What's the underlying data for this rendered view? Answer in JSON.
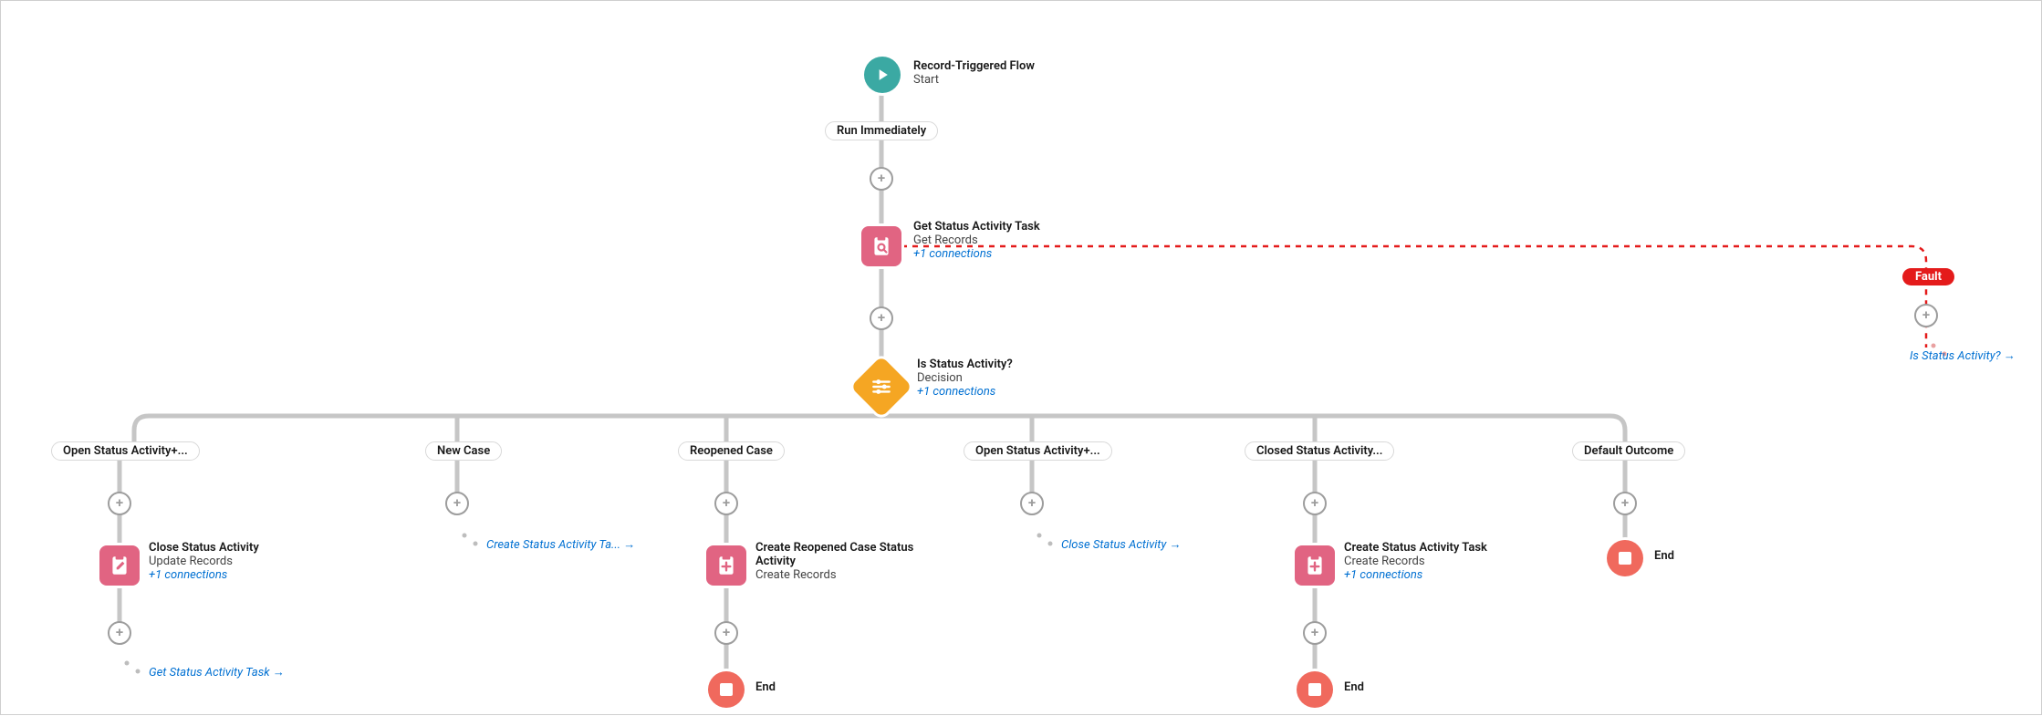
{
  "start": {
    "title": "Record-Triggered Flow",
    "sub": "Start",
    "run_label": "Run Immediately"
  },
  "get_records": {
    "title": "Get Status Activity Task",
    "sub": "Get Records",
    "link": "+1 connections"
  },
  "decision": {
    "title": "Is Status Activity?",
    "sub": "Decision",
    "link": "+1 connections"
  },
  "outcomes": {
    "o1": "Open Status Activity+...",
    "o2": "New Case",
    "o3": "Reopened Case",
    "o4": "Open Status Activity+...",
    "o5": "Closed Status Activity...",
    "o6": "Default Outcome"
  },
  "b1": {
    "title": "Close Status Activity",
    "sub": "Update Records",
    "link": "+1 connections",
    "goto": "Get Status Activity Task"
  },
  "b2": {
    "goto": "Create Status Activity Ta..."
  },
  "b3": {
    "title": "Create Reopened Case Status Activity",
    "sub": "Create Records"
  },
  "b4": {
    "goto": "Close Status Activity"
  },
  "b5": {
    "title": "Create Status Activity Task",
    "sub": "Create Records",
    "link": "+1 connections"
  },
  "end_label": "End",
  "fault": {
    "label": "Fault",
    "goto": "Is Status Activity?"
  }
}
